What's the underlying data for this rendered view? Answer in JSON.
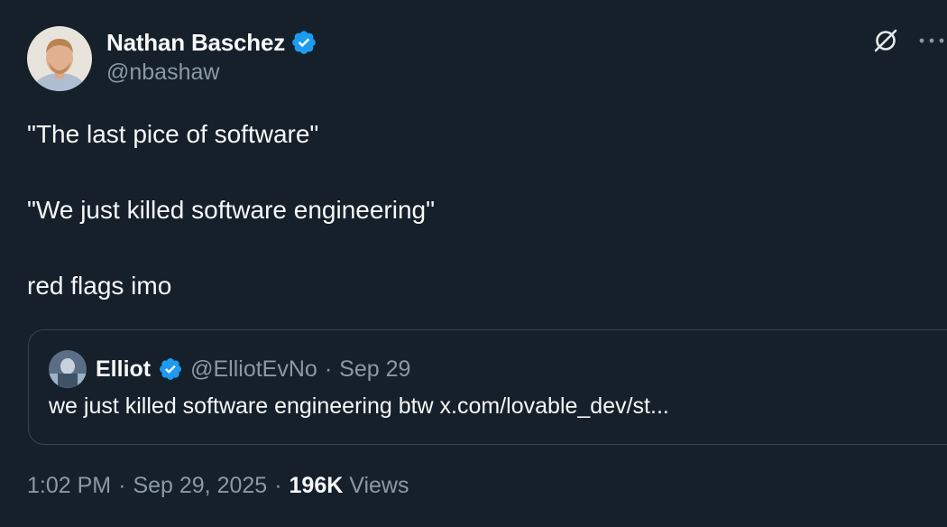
{
  "author": {
    "name": "Nathan Baschez",
    "handle": "@nbashaw",
    "verified": true,
    "avatar_icon": "profile-photo"
  },
  "tweet": {
    "lines": [
      "\"The last pice of software\"",
      "",
      "\"We just killed software engineering\"",
      "",
      "red flags imo"
    ]
  },
  "quote": {
    "name": "Elliot",
    "verified": true,
    "handle": "@ElliotEvNo",
    "separator": "·",
    "date": "Sep 29",
    "text": "we just killed software engineering btw x.com/lovable_dev/st..."
  },
  "meta": {
    "time": "1:02 PM",
    "sep1": "·",
    "date": "Sep 29, 2025",
    "sep2": "·",
    "views_count": "196K",
    "views_label": "Views"
  },
  "icons": {
    "grok": "grok-icon",
    "more": "more-icon",
    "verified": "verified-badge-icon"
  },
  "colors": {
    "background": "#15202b",
    "text_primary": "#f7f9f9",
    "text_secondary": "#8b98a5",
    "border": "#38444d",
    "verified_blue": "#1d9bf0"
  }
}
